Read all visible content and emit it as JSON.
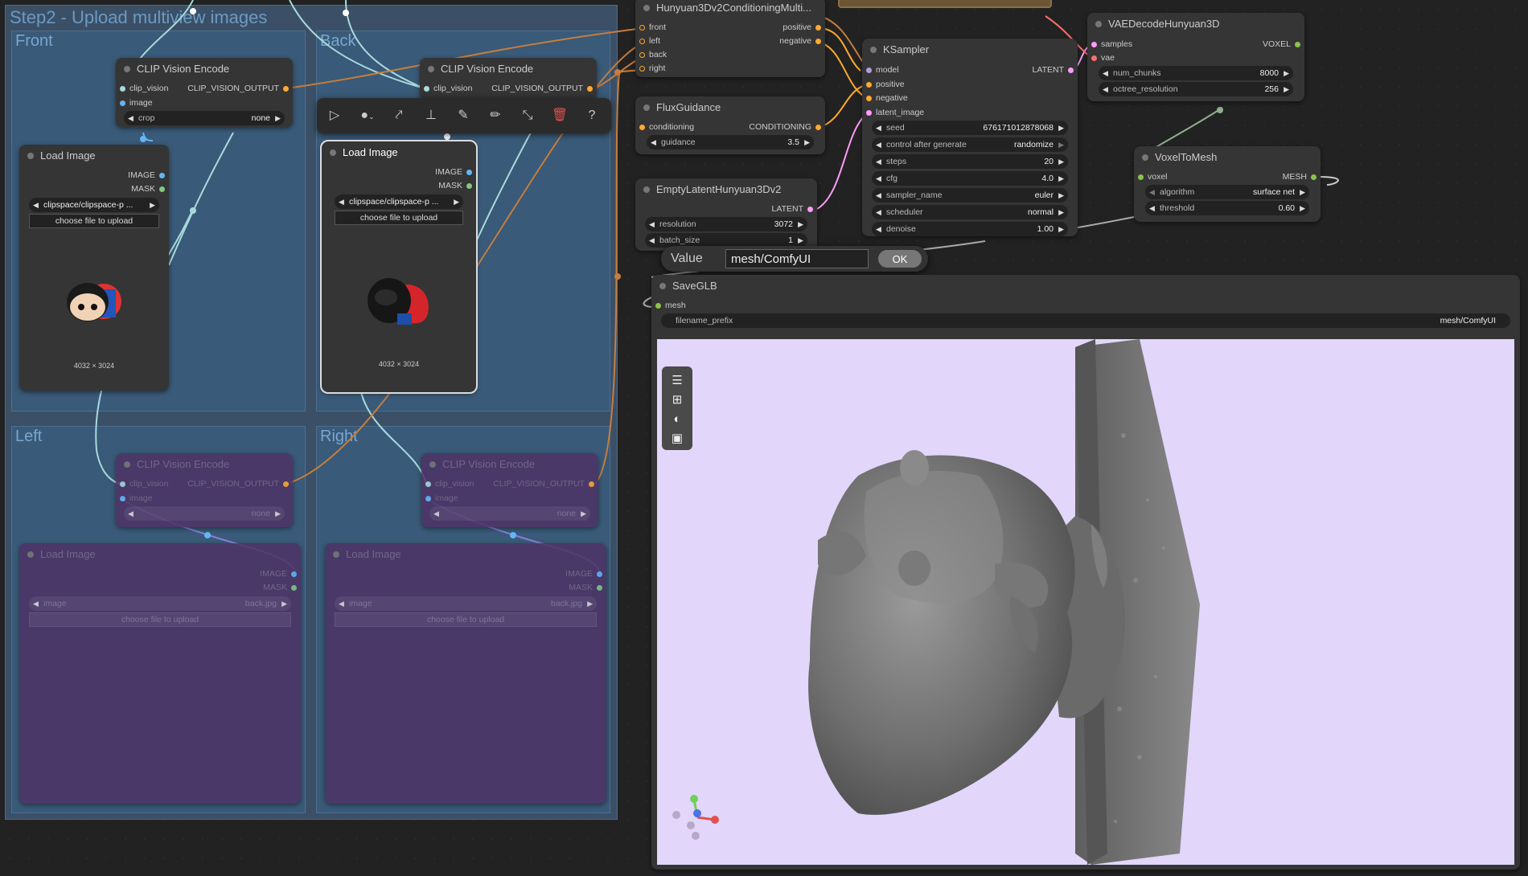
{
  "group_main": {
    "title": "Step2 - Upload multiview images"
  },
  "subgroups": {
    "front": "Front",
    "back": "Back",
    "left": "Left",
    "right": "Right"
  },
  "clip_front": {
    "title": "CLIP Vision Encode",
    "in1": "clip_vision",
    "in2": "image",
    "out": "CLIP_VISION_OUTPUT",
    "crop_label": "crop",
    "crop_value": "none"
  },
  "clip_back": {
    "title": "CLIP Vision Encode",
    "in1": "clip_vision",
    "out": "CLIP_VISION_OUTPUT"
  },
  "clip_left": {
    "title": "CLIP Vision Encode",
    "in1": "clip_vision",
    "in2": "image",
    "out": "CLIP_VISION_OUTPUT",
    "crop_value": "none"
  },
  "clip_right": {
    "title": "CLIP Vision Encode",
    "in1": "clip_vision",
    "in2": "image",
    "out": "CLIP_VISION_OUTPUT",
    "crop_value": "none"
  },
  "load_front": {
    "title": "Load Image",
    "out1": "IMAGE",
    "out2": "MASK",
    "file": "clipspace/clipspace-p ...",
    "upload": "choose file to upload",
    "dims": "4032 × 3024"
  },
  "load_back": {
    "title": "Load Image",
    "out1": "IMAGE",
    "out2": "MASK",
    "file": "clipspace/clipspace-p ...",
    "upload": "choose file to upload",
    "dims": "4032 × 3024"
  },
  "load_left": {
    "title": "Load Image",
    "out1": "IMAGE",
    "out2": "MASK",
    "label": "image",
    "file": "back.jpg",
    "upload": "choose file to upload"
  },
  "load_right": {
    "title": "Load Image",
    "out1": "IMAGE",
    "out2": "MASK",
    "label": "image",
    "file": "back.jpg",
    "upload": "choose file to upload"
  },
  "conditioning": {
    "title": "Hunyuan3Dv2ConditioningMulti...",
    "in": [
      "front",
      "left",
      "back",
      "right"
    ],
    "out": [
      "positive",
      "negative"
    ]
  },
  "flux": {
    "title": "FluxGuidance",
    "in": "conditioning",
    "out": "CONDITIONING",
    "guidance_label": "guidance",
    "guidance_value": "3.5"
  },
  "empty_latent": {
    "title": "EmptyLatentHunyuan3Dv2",
    "out": "LATENT",
    "resolution_label": "resolution",
    "resolution_value": "3072",
    "batch_label": "batch_size",
    "batch_value": "1"
  },
  "ksampler": {
    "title": "KSampler",
    "in": [
      "model",
      "positive",
      "negative",
      "latent_image"
    ],
    "out": "LATENT",
    "widgets": [
      {
        "label": "seed",
        "value": "676171012878068"
      },
      {
        "label": "control after generate",
        "value": "randomize"
      },
      {
        "label": "steps",
        "value": "20"
      },
      {
        "label": "cfg",
        "value": "4.0"
      },
      {
        "label": "sampler_name",
        "value": "euler"
      },
      {
        "label": "scheduler",
        "value": "normal"
      },
      {
        "label": "denoise",
        "value": "1.00"
      }
    ]
  },
  "vae_decode": {
    "title": "VAEDecodeHunyuan3D",
    "in": [
      "samples",
      "vae"
    ],
    "out": "VOXEL",
    "widgets": [
      {
        "label": "num_chunks",
        "value": "8000"
      },
      {
        "label": "octree_resolution",
        "value": "256"
      }
    ]
  },
  "voxel_mesh": {
    "title": "VoxelToMesh",
    "in": "voxel",
    "out": "MESH",
    "widgets": [
      {
        "label": "algorithm",
        "value": "surface net"
      },
      {
        "label": "threshold",
        "value": "0.60"
      }
    ]
  },
  "value_dialog": {
    "label": "Value",
    "input_value": "mesh/ComfyUI",
    "ok": "OK"
  },
  "save_glb": {
    "title": "SaveGLB",
    "in": "mesh",
    "prefix_label": "filename_prefix",
    "prefix_value": "mesh/ComfyUI"
  },
  "colors": {
    "clip": "#ffd500",
    "clip_vision": "#a8dadc",
    "image": "#64b5f6",
    "mask": "#81c784",
    "model": "#b39ddb",
    "cond": "#ffa931",
    "latent": "#ff9cf9",
    "vae": "#ff6e6e",
    "voxel": "#8bc34a",
    "viewport_bg": "#e2d6fa"
  }
}
